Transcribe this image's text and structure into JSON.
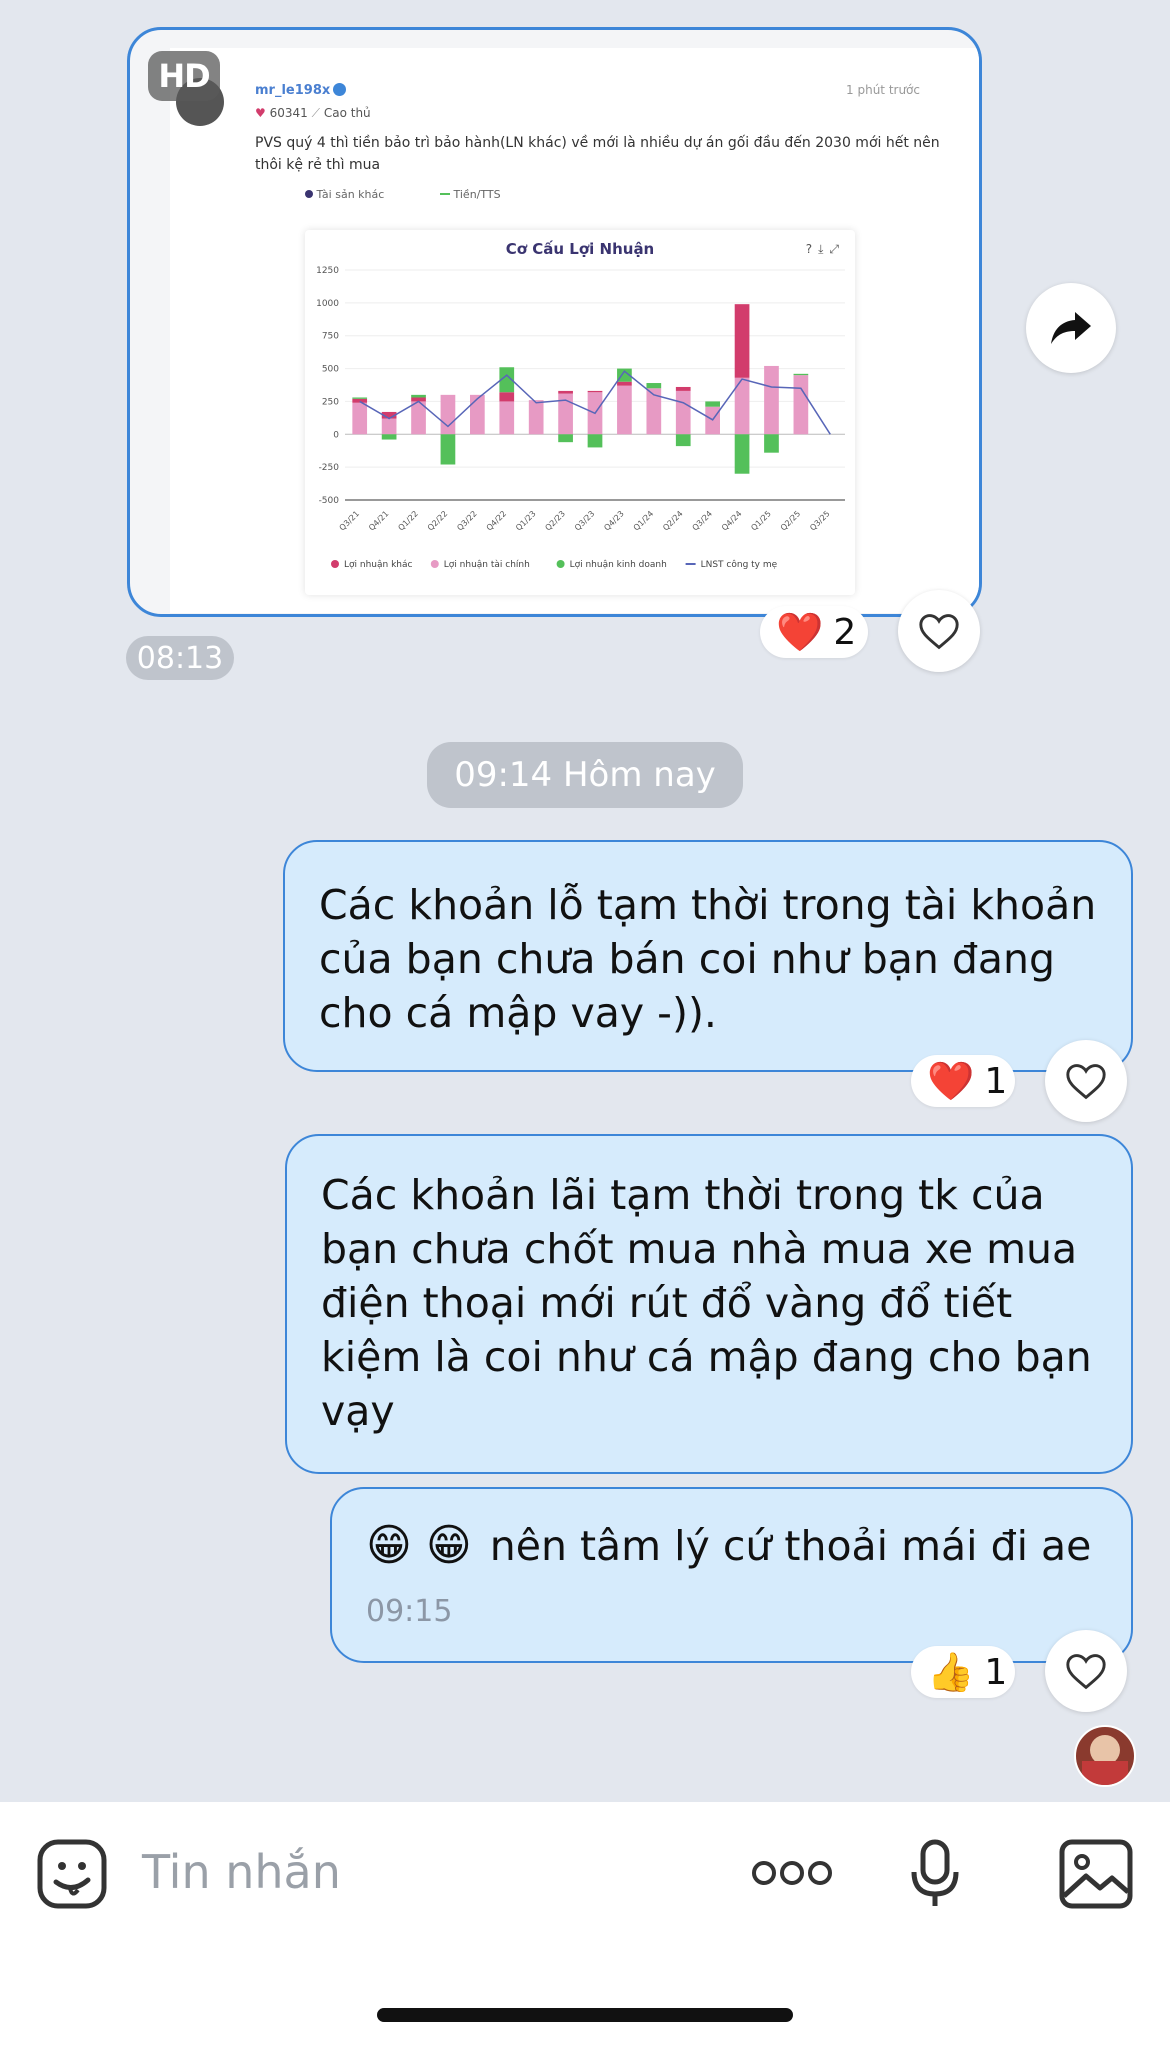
{
  "photo_post": {
    "hd_label": "HD",
    "username": "mr_le198x",
    "followers": "60341",
    "rank": "Cao thủ",
    "posted": "1 phút trước",
    "text": "PVS quý 4 thì tiền bảo trì bảo hành(LN khác) về mới là nhiều dự án gối đầu đến 2030 mới hết nên thôi kệ rẻ thì mua",
    "legend_top": [
      "Tài sản khác",
      "Tiền/TTS"
    ]
  },
  "chart_data": {
    "type": "bar",
    "title": "Cơ Cấu Lợi Nhuận",
    "categories": [
      "Q3/21",
      "Q4/21",
      "Q1/22",
      "Q2/22",
      "Q3/22",
      "Q4/22",
      "Q1/23",
      "Q2/23",
      "Q3/23",
      "Q4/23",
      "Q1/24",
      "Q2/24",
      "Q3/24",
      "Q4/24",
      "Q1/25",
      "Q2/25",
      "Q3/25"
    ],
    "ylim": [
      -500,
      1250
    ],
    "yticks": [
      1250,
      1000,
      750,
      500,
      250,
      0,
      -250,
      -500
    ],
    "series": [
      {
        "name": "Lợi nhuận khác",
        "color": "#d23c6c",
        "values": [
          30,
          50,
          30,
          0,
          0,
          70,
          0,
          20,
          10,
          30,
          0,
          30,
          0,
          560,
          0,
          0,
          0
        ]
      },
      {
        "name": "Lợi nhuận tài chính",
        "color": "#e79ac4",
        "values": [
          240,
          120,
          250,
          300,
          300,
          250,
          260,
          310,
          320,
          370,
          350,
          330,
          210,
          430,
          520,
          450,
          0
        ]
      },
      {
        "name": "Lợi nhuận kinh doanh",
        "color": "#54c05a",
        "values": [
          10,
          -40,
          20,
          -230,
          0,
          190,
          0,
          -60,
          -100,
          100,
          40,
          -90,
          40,
          -300,
          -140,
          10,
          0
        ]
      }
    ],
    "line": {
      "name": "LNST công ty mẹ",
      "color": "#5866b8",
      "values": [
        250,
        120,
        250,
        60,
        270,
        450,
        240,
        260,
        160,
        480,
        300,
        240,
        110,
        420,
        360,
        350,
        0
      ]
    }
  },
  "photo_reaction": {
    "emoji": "❤️",
    "count": "2"
  },
  "photo_time": "08:13",
  "date_separator": "09:14 Hôm nay",
  "messages": [
    {
      "text": "Các khoản lỗ tạm thời trong tài khoản của bạn chưa bán coi như bạn đang cho cá mập vay -)).",
      "reaction_emoji": "❤️",
      "reaction_count": "1"
    },
    {
      "text": "Các khoản lãi tạm thời trong tk của bạn chưa chốt mua nhà mua xe mua điện thoại mới rút đổ vàng đổ tiết kiệm là coi như cá mập đang cho bạn vạy"
    },
    {
      "emojis": "😁 😁",
      "text": "nên tâm lý cứ thoải mái đi ae",
      "time": "09:15",
      "reaction_emoji": "👍",
      "reaction_count": "1"
    }
  ],
  "input": {
    "placeholder": "Tin nhắn"
  }
}
